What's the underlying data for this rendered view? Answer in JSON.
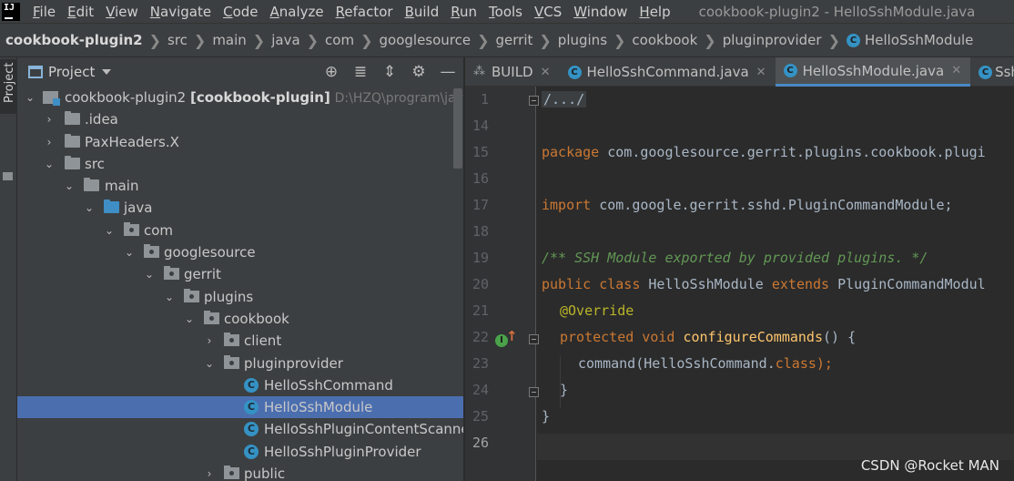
{
  "menubar": {
    "logo": "IJ",
    "items": [
      "File",
      "Edit",
      "View",
      "Navigate",
      "Code",
      "Analyze",
      "Refactor",
      "Build",
      "Run",
      "Tools",
      "VCS",
      "Window",
      "Help"
    ],
    "window_title": "cookbook-plugin2 - HelloSshModule.java"
  },
  "breadcrumb": {
    "items": [
      "cookbook-plugin2",
      "src",
      "main",
      "java",
      "com",
      "googlesource",
      "gerrit",
      "plugins",
      "cookbook",
      "pluginprovider",
      "HelloSshModule"
    ]
  },
  "tool_strip": {
    "label": "Project"
  },
  "project_panel": {
    "title": "Project",
    "tree": {
      "root": {
        "name": "cookbook-plugin2",
        "module": "[cookbook-plugin]",
        "path": "D:\\HZQ\\program\\java"
      },
      "idea": ".idea",
      "paxheaders": "PaxHeaders.X",
      "src": "src",
      "main": "main",
      "java": "java",
      "com": "com",
      "googlesource": "googlesource",
      "gerrit": "gerrit",
      "plugins": "plugins",
      "cookbook": "cookbook",
      "client": "client",
      "pluginprovider": "pluginprovider",
      "classes": [
        "HelloSshCommand",
        "HelloSshModule",
        "HelloSshPluginContentScanner",
        "HelloSshPluginProvider"
      ],
      "public": "public"
    }
  },
  "editor": {
    "tabs": [
      {
        "label": "BUILD"
      },
      {
        "label": "HelloSshCommand.java"
      },
      {
        "label": "HelloSshModule.java"
      },
      {
        "label": "SshC"
      }
    ],
    "line_numbers": [
      "1",
      "14",
      "15",
      "16",
      "17",
      "18",
      "19",
      "20",
      "21",
      "22",
      "23",
      "24",
      "25",
      "26"
    ],
    "code": {
      "l1_folded": "/.../",
      "l15_kw": "package",
      "l15_rest": " com.googlesource.gerrit.plugins.cookbook.plugi",
      "l17_kw": "import",
      "l17_rest": " com.google.gerrit.sshd.PluginCommandModule;",
      "l19_comment": "/** SSH Module exported by provided plugins. */",
      "l20_kw1": "public class",
      "l20_name": " HelloSshModule ",
      "l20_kw2": "extends",
      "l20_rest": " PluginCommandModul",
      "l21_ann": "@Override",
      "l22_kw": "protected void",
      "l22_fn": "configureCommands",
      "l22_rest": "() {",
      "l23_pre": "command(HelloSshCommand.",
      "l23_kw": "class",
      "l23_post": ");",
      "l24": "}",
      "l25": "}"
    }
  },
  "watermark": "CSDN @Rocket MAN"
}
